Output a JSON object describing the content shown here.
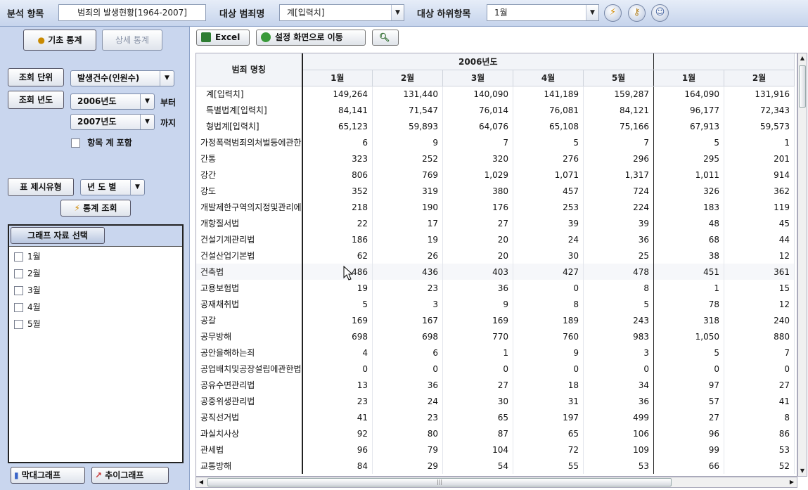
{
  "topbar": {
    "analysis_label": "분석 항목",
    "analysis_value": "범죄의 발생현황[1964-2007]",
    "target_label": "대상 범죄명",
    "target_value": "계[입력치]",
    "sub_label": "대상 하위항목",
    "sub_value": "1월"
  },
  "left": {
    "tab_basic": "기초 통계",
    "tab_detail": "상세 통계",
    "unit_btn": "조회 단위",
    "unit_value": "발생건수(인원수)",
    "year_btn": "조회 년도",
    "year_from": "2006년도",
    "from_suffix": "부터",
    "year_to": "2007년도",
    "to_suffix": "까지",
    "include_total": "항목 계 포함",
    "display_btn": "표 제시유형",
    "display_value": "년 도 별",
    "query_btn": "통계 조회",
    "graph_header": "그래프 자료 선택",
    "graph_items": [
      "1월",
      "2월",
      "3월",
      "4월",
      "5월"
    ],
    "bar_graph": "막대그래프",
    "trend_graph": "추이그래프"
  },
  "toolbar": {
    "excel": "Excel",
    "goto_settings": "설정 화면으로 이동"
  },
  "table": {
    "name_header": "범죄 명칭",
    "year_groups": [
      "2006년도",
      ""
    ],
    "month_headers": [
      "1월",
      "2월",
      "3월",
      "4월",
      "5월",
      "1월",
      "2월"
    ],
    "rows": [
      {
        "name": "계[입력치]",
        "indent": 1,
        "values": [
          "149,264",
          "131,440",
          "140,090",
          "141,189",
          "159,287",
          "164,090",
          "131,916"
        ]
      },
      {
        "name": "특별법계[입력치]",
        "indent": 1,
        "values": [
          "84,141",
          "71,547",
          "76,014",
          "76,081",
          "84,121",
          "96,177",
          "72,343"
        ]
      },
      {
        "name": "형법계[입력치]",
        "indent": 1,
        "values": [
          "65,123",
          "59,893",
          "64,076",
          "65,108",
          "75,166",
          "67,913",
          "59,573"
        ]
      },
      {
        "name": "가정폭력범죄의처벌등에관한",
        "indent": 0,
        "values": [
          "6",
          "9",
          "7",
          "5",
          "7",
          "5",
          "1"
        ]
      },
      {
        "name": "간통",
        "indent": 0,
        "values": [
          "323",
          "252",
          "320",
          "276",
          "296",
          "295",
          "201"
        ]
      },
      {
        "name": "강간",
        "indent": 0,
        "values": [
          "806",
          "769",
          "1,029",
          "1,071",
          "1,317",
          "1,011",
          "914"
        ]
      },
      {
        "name": "강도",
        "indent": 0,
        "values": [
          "352",
          "319",
          "380",
          "457",
          "724",
          "326",
          "362"
        ]
      },
      {
        "name": "개발제한구역의지정및관리에",
        "indent": 0,
        "values": [
          "218",
          "190",
          "176",
          "253",
          "224",
          "183",
          "119"
        ]
      },
      {
        "name": "개항질서법",
        "indent": 0,
        "values": [
          "22",
          "17",
          "27",
          "39",
          "39",
          "48",
          "45"
        ]
      },
      {
        "name": "건설기계관리법",
        "indent": 0,
        "values": [
          "186",
          "19",
          "20",
          "24",
          "36",
          "68",
          "44"
        ]
      },
      {
        "name": "건설산업기본법",
        "indent": 0,
        "values": [
          "62",
          "26",
          "20",
          "30",
          "25",
          "38",
          "12"
        ]
      },
      {
        "name": "건축법",
        "indent": 0,
        "values": [
          "486",
          "436",
          "403",
          "427",
          "478",
          "451",
          "361"
        ]
      },
      {
        "name": "고용보험법",
        "indent": 0,
        "values": [
          "19",
          "23",
          "36",
          "0",
          "8",
          "1",
          "15"
        ]
      },
      {
        "name": "공재채취법",
        "indent": 0,
        "values": [
          "5",
          "3",
          "9",
          "8",
          "5",
          "78",
          "12"
        ]
      },
      {
        "name": "공갈",
        "indent": 0,
        "values": [
          "169",
          "167",
          "169",
          "189",
          "243",
          "318",
          "240"
        ]
      },
      {
        "name": "공무방해",
        "indent": 0,
        "values": [
          "698",
          "698",
          "770",
          "760",
          "983",
          "1,050",
          "880"
        ]
      },
      {
        "name": "공안을해하는죄",
        "indent": 0,
        "values": [
          "4",
          "6",
          "1",
          "9",
          "3",
          "5",
          "7"
        ]
      },
      {
        "name": "공업배치및공장설립에관한법",
        "indent": 0,
        "values": [
          "0",
          "0",
          "0",
          "0",
          "0",
          "0",
          "0"
        ]
      },
      {
        "name": "공유수면관리법",
        "indent": 0,
        "values": [
          "13",
          "36",
          "27",
          "18",
          "34",
          "97",
          "27"
        ]
      },
      {
        "name": "공중위생관리법",
        "indent": 0,
        "values": [
          "23",
          "24",
          "30",
          "31",
          "36",
          "57",
          "41"
        ]
      },
      {
        "name": "공직선거법",
        "indent": 0,
        "values": [
          "41",
          "23",
          "65",
          "197",
          "499",
          "27",
          "8"
        ]
      },
      {
        "name": "과실치사상",
        "indent": 0,
        "values": [
          "92",
          "80",
          "87",
          "65",
          "106",
          "96",
          "86"
        ]
      },
      {
        "name": "관세법",
        "indent": 0,
        "values": [
          "96",
          "79",
          "104",
          "72",
          "109",
          "99",
          "53"
        ]
      },
      {
        "name": "교통방해",
        "indent": 0,
        "values": [
          "84",
          "29",
          "54",
          "55",
          "53",
          "66",
          "52"
        ]
      }
    ]
  }
}
